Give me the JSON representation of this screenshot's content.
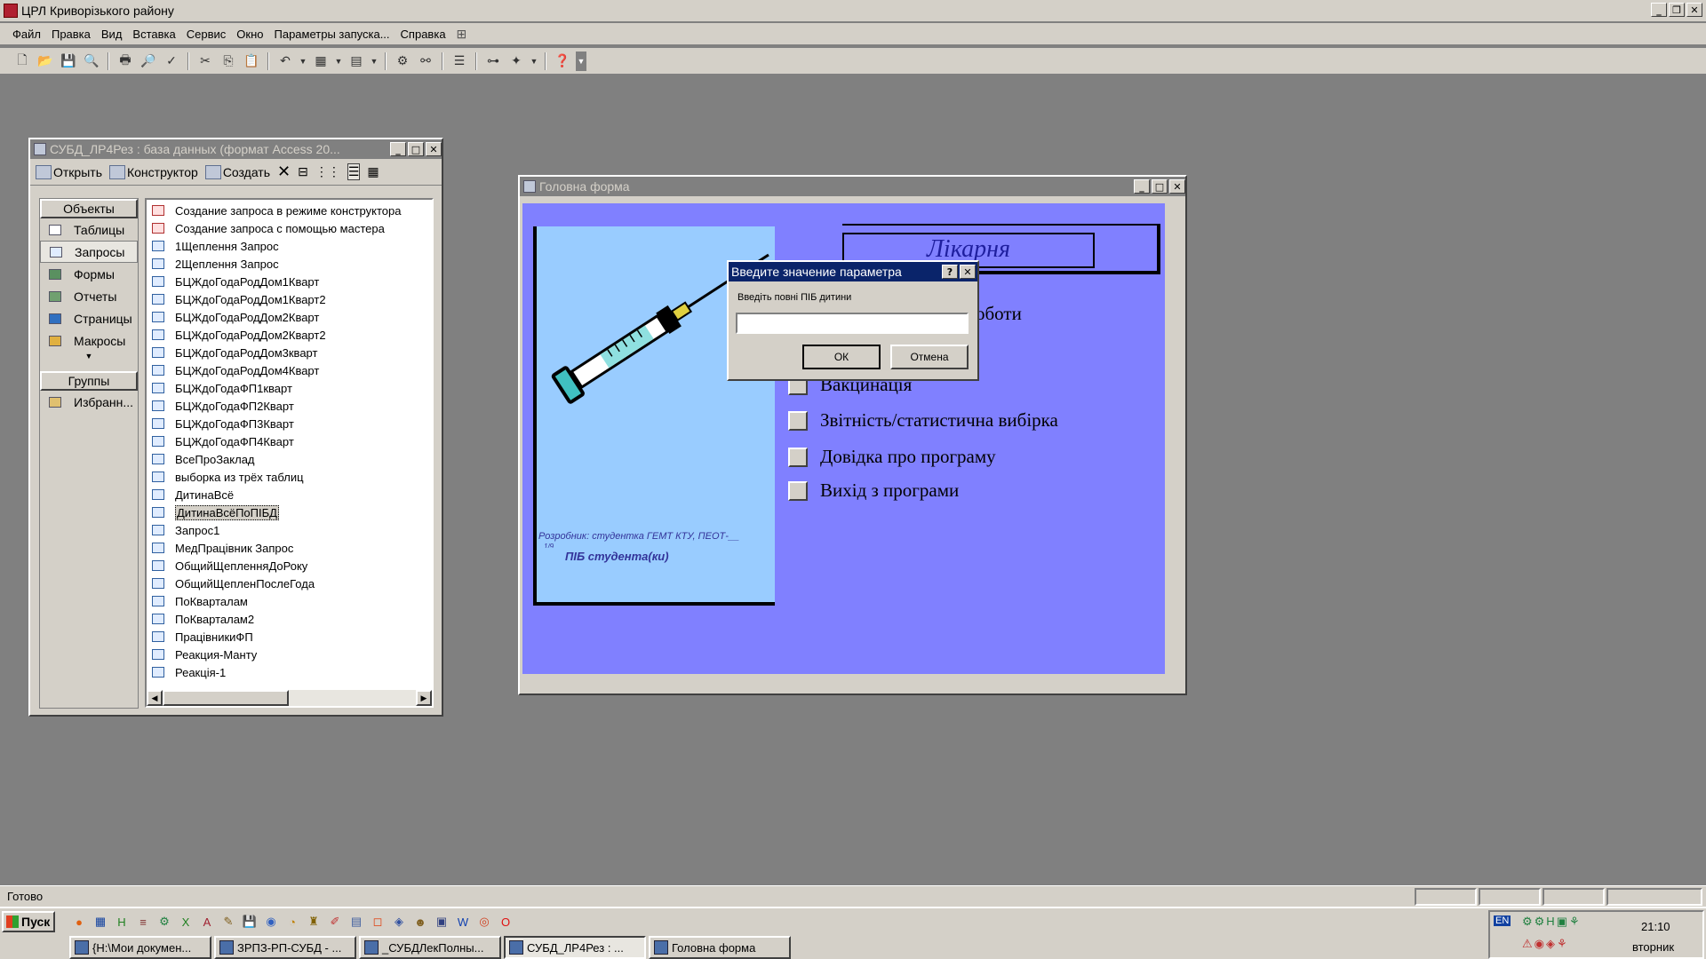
{
  "app": {
    "title": "ЦРЛ Криворізького району",
    "menu": [
      "Файл",
      "Правка",
      "Вид",
      "Вставка",
      "Сервис",
      "Окно",
      "Параметры запуска...",
      "Справка"
    ],
    "status": "Готово"
  },
  "db_window": {
    "title": "СУБД_ЛР4Рез : база данных (формат Access 20...",
    "toolbar": {
      "open": "Открыть",
      "design": "Конструктор",
      "create": "Создать"
    },
    "objects_header": "Объекты",
    "objects": [
      "Таблицы",
      "Запросы",
      "Формы",
      "Отчеты",
      "Страницы",
      "Макросы"
    ],
    "selected_object": "Запросы",
    "groups_header": "Группы",
    "groups": [
      "Избранн..."
    ],
    "queries": [
      "Создание запроса в режиме конструктора",
      "Создание запроса с помощью мастера",
      "1Щеплення Запрос",
      "2Щеплення Запрос",
      "БЦЖдоГодаРодДом1Кварт",
      "БЦЖдоГодаРодДом1Кварт2",
      "БЦЖдоГодаРодДом2Кварт",
      "БЦЖдоГодаРодДом2Кварт2",
      "БЦЖдоГодаРодДом3кварт",
      "БЦЖдоГодаРодДом4Кварт",
      "БЦЖдоГодаФП1кварт",
      "БЦЖдоГодаФП2Кварт",
      "БЦЖдоГодаФП3Кварт",
      "БЦЖдоГодаФП4Кварт",
      "ВсеПроЗаклад",
      "выборка из трёх таблиц",
      "ДитинаВсё",
      "ДитинаВсёПоПІБД",
      "Запрос1",
      "МедПрацівник Запрос",
      "ОбщийЩепленняДоРоку",
      "ОбщийЩепленПослеГода",
      "ПоКварталам",
      "ПоКварталам2",
      "ПрацівникиФП",
      "Реакция-Манту",
      "Реакція-1"
    ],
    "selected_query": "ДитинаВсёПоПІБД"
  },
  "main_form": {
    "title": "Головна форма",
    "heading": "Лікарня",
    "partial_item": "оботи",
    "items": [
      "Вакцинація",
      "Звітність/статистична вибірка",
      "Довідка про програму",
      "Вихід з програми"
    ],
    "developer": "Розробник: студентка ГЕМТ КТУ, ПЕОТ-__",
    "developer_cont": "1/9",
    "student": "ПІБ студента(ки)"
  },
  "dialog": {
    "title": "Введите значение параметра",
    "prompt": "Введіть повні ПІБ дитини",
    "value": "",
    "ok": "ОК",
    "cancel": "Отмена"
  },
  "taskbar": {
    "start": "Пуск",
    "tasks": [
      "{H:\\Мои докумен...",
      "ЗРПЗ-РП-СУБД - ...",
      "_СУБДЛекПолны...",
      "СУБД_ЛР4Рез : ...",
      "Головна форма"
    ],
    "active_task": "СУБД_ЛР4Рез : ...",
    "lang": "EN",
    "time": "21:10",
    "day": "вторник"
  },
  "colors": {
    "form_bg": "#8080ff",
    "panel_bg": "#99ccff",
    "title_active": "#0a246a",
    "chrome": "#d4d0c8"
  }
}
